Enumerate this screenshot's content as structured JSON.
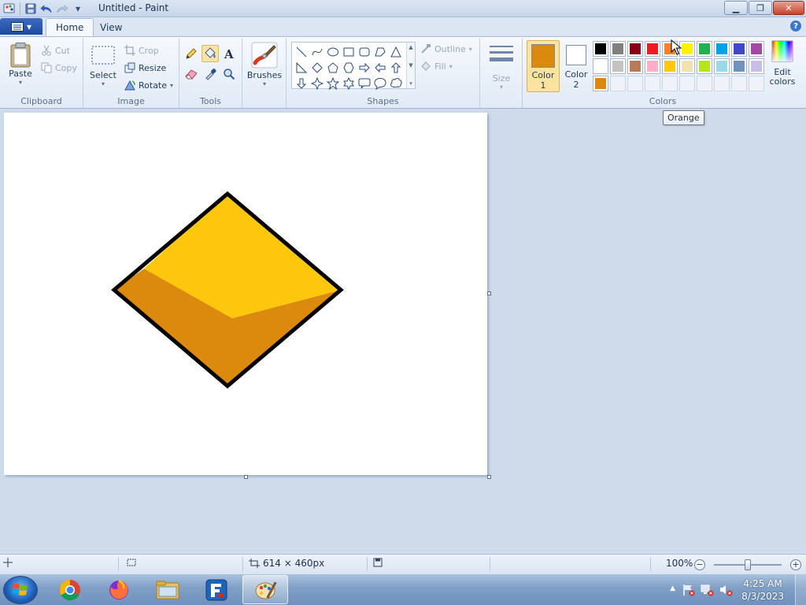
{
  "window": {
    "title": "Untitled - Paint",
    "controls": {
      "minimize": "▁",
      "restore": "❐",
      "close": "✕"
    }
  },
  "quick_access": {
    "icons": [
      "paint-app-icon",
      "save-icon",
      "undo-icon",
      "redo-icon",
      "customize-dropdown-icon"
    ],
    "dropdown": "▾"
  },
  "tabs": [
    {
      "label": "Home",
      "active": true
    },
    {
      "label": "View",
      "active": false
    }
  ],
  "help": "?",
  "ribbon": {
    "clipboard": {
      "group_label": "Clipboard",
      "paste": "Paste",
      "paste_arrow": "▾",
      "cut": "Cut",
      "copy": "Copy"
    },
    "image": {
      "group_label": "Image",
      "select": "Select",
      "select_arrow": "▾",
      "crop": "Crop",
      "resize": "Resize",
      "rotate": "Rotate",
      "rotate_arrow": "▾"
    },
    "tools": {
      "group_label": "Tools",
      "items": [
        "pencil",
        "fill",
        "text",
        "eraser",
        "color-picker",
        "magnifier"
      ],
      "active": "fill"
    },
    "brushes": {
      "label": "Brushes",
      "arrow": "▾"
    },
    "shapes": {
      "group_label": "Shapes",
      "items": [
        "line",
        "curve",
        "oval",
        "rectangle",
        "rounded-rectangle",
        "polygon",
        "triangle",
        "right-triangle",
        "diamond",
        "pentagon",
        "hexagon",
        "right-arrow",
        "left-arrow",
        "up-arrow",
        "down-arrow",
        "four-point-star",
        "five-point-star",
        "six-point-star",
        "rounded-callout",
        "oval-callout",
        "cloud-callout"
      ],
      "outline": "Outline",
      "fill": "Fill",
      "arrow": "▾"
    },
    "size": {
      "label": "Size",
      "arrow": "▾"
    },
    "colors": {
      "group_label": "Colors",
      "color1": {
        "line1": "Color",
        "line2": "1",
        "value": "#dc8a0e"
      },
      "color2": {
        "line1": "Color",
        "line2": "2",
        "value": "#ffffff"
      },
      "palette_row1": [
        "#000000",
        "#7f7f7f",
        "#880015",
        "#ed1c24",
        "#ff7f27",
        "#fff200",
        "#22b14c",
        "#00a2e8",
        "#3f48cc",
        "#a349a4"
      ],
      "palette_row2": [
        "#ffffff",
        "#c3c3c3",
        "#b97a57",
        "#ffaec9",
        "#ffc90e",
        "#efe4b0",
        "#b5e61d",
        "#99d9ea",
        "#7092be",
        "#c8bfe7"
      ],
      "palette_row3": [
        "#dc8a0e",
        "",
        "",
        "",
        "",
        "",
        "",
        "",
        "",
        ""
      ],
      "edit_line1": "Edit",
      "edit_line2": "colors"
    }
  },
  "tooltip": "Orange",
  "drawing": {
    "outline_color": "#000000",
    "top_color": "#fdc70c",
    "bottom_color": "#dc8a0e"
  },
  "statusbar": {
    "image_size": "614 × 460px",
    "zoom": "100%",
    "zoom_out": "−",
    "zoom_in": "+"
  },
  "taskbar": {
    "apps": [
      {
        "name": "chrome-icon",
        "active": false
      },
      {
        "name": "firefox-icon",
        "active": false
      },
      {
        "name": "file-explorer-icon",
        "active": false
      },
      {
        "name": "filezilla-icon",
        "active": false
      },
      {
        "name": "paint-icon",
        "active": true
      }
    ],
    "time": "4:25 AM",
    "date": "8/3/2023",
    "tray_arrow": "▲"
  }
}
